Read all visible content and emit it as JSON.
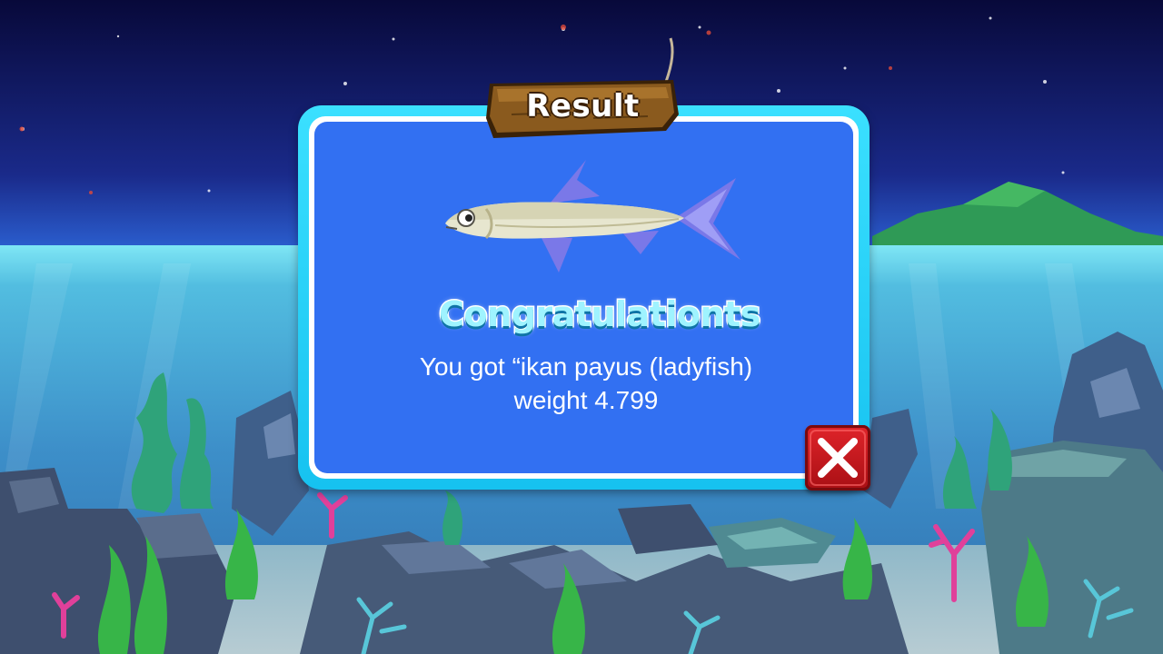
{
  "dialog": {
    "title": "Result",
    "heading": "Congratulationts",
    "message_line1": "You got “ikan payus (ladyfish)",
    "message_line2": "weight 4.799",
    "fish_icon": "ladyfish-icon",
    "close_icon": "close-x-icon"
  },
  "colors": {
    "frame": "#16c2f0",
    "panel": "#3270f2",
    "close_button": "#d11b21",
    "plank": "#8a5a1e",
    "sky": "#0b0d3c",
    "water": "#3d8fc9"
  }
}
